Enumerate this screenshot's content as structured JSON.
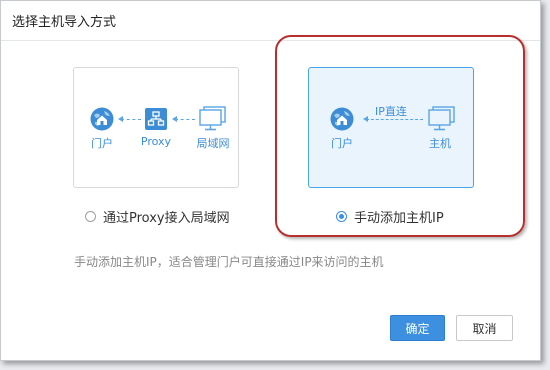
{
  "dialog": {
    "title": "选择主机导入方式",
    "description": "手动添加主机IP，适合管理门户可直接通过IP来访问的主机"
  },
  "options": [
    {
      "label": "通过Proxy接入局域网",
      "selected": false,
      "nodes": {
        "portal": "门户",
        "proxy": "Proxy",
        "lan": "局域网"
      }
    },
    {
      "label": "手动添加主机IP",
      "selected": true,
      "nodes": {
        "portal": "门户",
        "host": "主机"
      },
      "edge_label": "IP直连"
    }
  ],
  "buttons": {
    "confirm": "确定",
    "cancel": "取消"
  },
  "colors": {
    "accent": "#3d8fe0",
    "highlight_annotation": "#b72f2f",
    "icon_blue": "#3c8dd6"
  },
  "icons": [
    "globe-home-icon",
    "network-proxy-icon",
    "monitor-icon"
  ]
}
